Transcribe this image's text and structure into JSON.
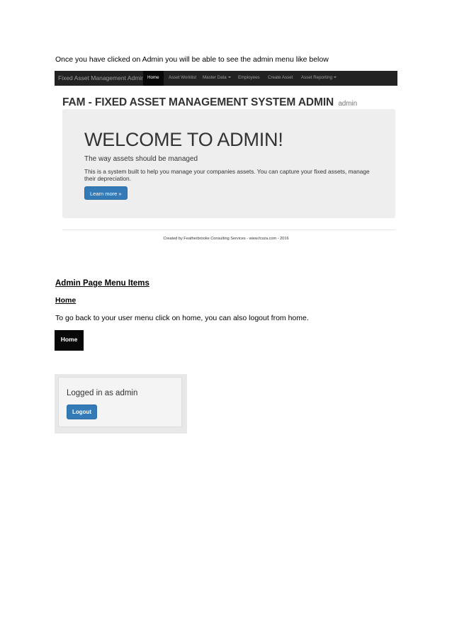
{
  "intro": "Once you have clicked on Admin you will be able to see the admin menu like below",
  "screenshot": {
    "brand": "Fixed Asset Management Admin",
    "nav": [
      "Home",
      "Asset Worklist",
      "Master Data",
      "Employees",
      "Create Asset",
      "Asset Reporting"
    ],
    "title": "FAM - FIXED ASSET MANAGEMENT SYSTEM ADMIN",
    "title_small": "admin",
    "jumbotron": {
      "heading": "WELCOME TO ADMIN!",
      "lead": "The way assets should be managed",
      "body": "This is a system built to help you manage your companies assets. You can capture your fixed assets, manage their depreciation.",
      "button": "Learn more »"
    },
    "footer": "Created by Featherbrooke Consulting Services - www.fcsza.com - 2016"
  },
  "section_heading": "Admin Page Menu Items",
  "sub_heading": "Home",
  "body_text": "To go back to your user menu click on home, you can also logout from home.",
  "home_button": "Home",
  "login_panel": {
    "text": "Logged in as admin",
    "button": "Logout"
  },
  "colors": {
    "navbar": "#222222",
    "primary_button": "#337ab7",
    "jumbotron": "#eeeeee"
  }
}
